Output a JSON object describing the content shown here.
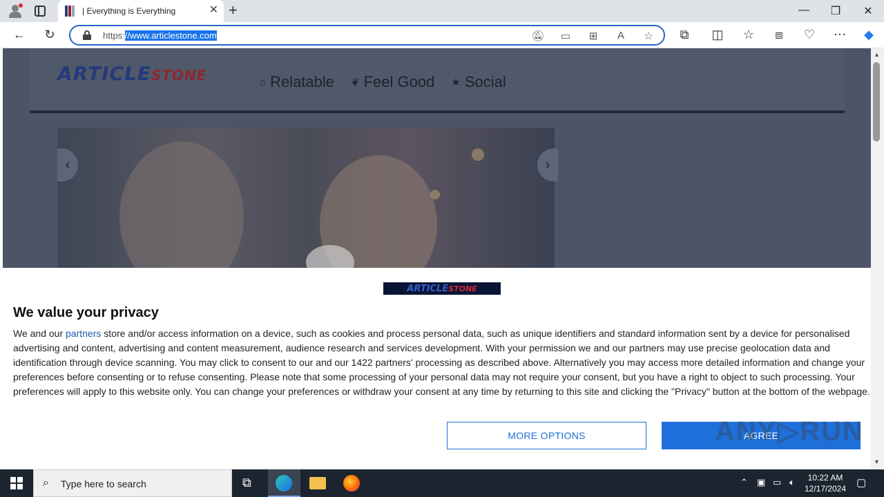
{
  "browser": {
    "tab_title": "| Everything is Everything",
    "url_prefix": "https:",
    "url_selected": "//www.articlestone.com",
    "new_tab_glyph": "+",
    "close_glyph": "✕",
    "minimize_glyph": "—",
    "restore_glyph": "❐",
    "window_close_glyph": "✕"
  },
  "site": {
    "logo_main": "ARTICLE",
    "logo_sub": "STONE",
    "nav": [
      {
        "icon": "home-icon",
        "label": "Relatable"
      },
      {
        "icon": "leaf-icon",
        "label": "Feel Good"
      },
      {
        "icon": "star-icon",
        "label": "Social"
      }
    ]
  },
  "consent": {
    "title": "We value your privacy",
    "text_before_link": "We and our ",
    "link": "partners",
    "text_after_link": " store and/or access information on a device, such as cookies and process personal data, such as unique identifiers and standard information sent by a device for personalised advertising and content, advertising and content measurement, audience research and services development. With your permission we and our partners may use precise geolocation data and identification through device scanning. You may click to consent to our and our 1422 partners' processing as described above. Alternatively you may access more detailed information and change your preferences before consenting or to refuse consenting. Please note that some processing of your personal data may not require your consent, but you have a right to object to such processing. Your preferences will apply to this website only. You can change your preferences or withdraw your consent at any time by returning to this site and clicking the \"Privacy\" button at the bottom of the webpage.",
    "more_options": "MORE OPTIONS",
    "agree": "AGREE"
  },
  "watermark": "ANY▷RUN",
  "taskbar": {
    "search_placeholder": "Type here to search",
    "time": "10:22 AM",
    "date": "12/17/2024"
  },
  "colors": {
    "accent": "#1e6fd9",
    "overlay": "#4b5565",
    "taskbar": "#1c2430"
  }
}
